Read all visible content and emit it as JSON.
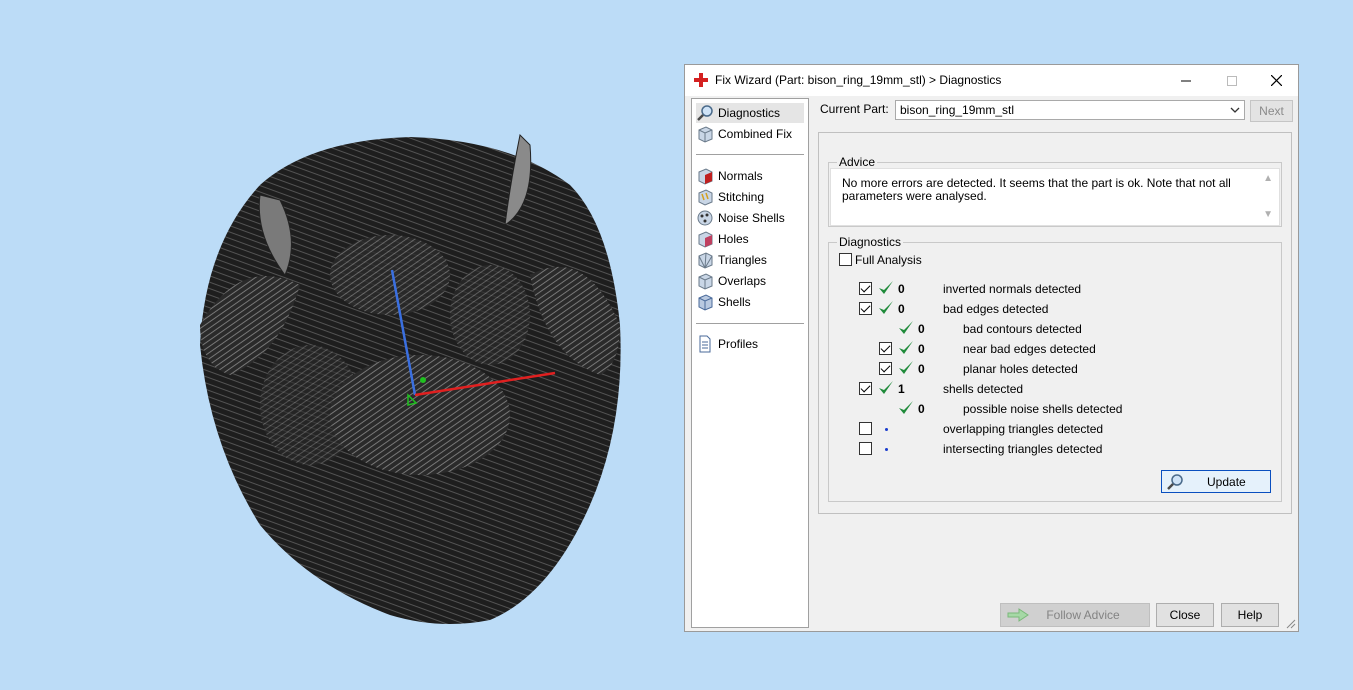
{
  "window": {
    "title": "Fix Wizard (Part: bison_ring_19mm_stl) > Diagnostics",
    "minimize_icon": "minimize-icon",
    "maximize_icon": "maximize-icon",
    "close_icon": "close-icon"
  },
  "nav": {
    "top": [
      {
        "label": "Diagnostics",
        "icon": "magnifier-icon",
        "selected": true
      },
      {
        "label": "Combined Fix",
        "icon": "cube-icon"
      }
    ],
    "fixes": [
      {
        "label": "Normals",
        "icon": "normals-cube-icon"
      },
      {
        "label": "Stitching",
        "icon": "stitching-cube-icon"
      },
      {
        "label": "Noise Shells",
        "icon": "noise-shells-icon"
      },
      {
        "label": "Holes",
        "icon": "holes-cube-icon"
      },
      {
        "label": "Triangles",
        "icon": "triangles-cube-icon"
      },
      {
        "label": "Overlaps",
        "icon": "overlaps-cube-icon"
      },
      {
        "label": "Shells",
        "icon": "shells-cube-icon"
      }
    ],
    "bottom": [
      {
        "label": "Profiles",
        "icon": "document-icon"
      }
    ]
  },
  "current_part": {
    "label": "Current Part:",
    "value": "bison_ring_19mm_stl",
    "next_label": "Next"
  },
  "advice": {
    "title": "Advice",
    "text": "No more errors are detected. It seems that the part is ok. Note that not all parameters were analysed."
  },
  "diagnostics": {
    "title": "Diagnostics",
    "full_analysis_label": "Full Analysis",
    "full_analysis_checked": false,
    "rows": [
      {
        "checkbox": true,
        "checked": true,
        "status": "ok",
        "count": "0",
        "label": "inverted normals detected",
        "indent": 0
      },
      {
        "checkbox": true,
        "checked": true,
        "status": "ok",
        "count": "0",
        "label": "bad edges detected",
        "indent": 0
      },
      {
        "checkbox": false,
        "checked": false,
        "status": "ok",
        "count": "0",
        "label": "bad contours detected",
        "indent": 1
      },
      {
        "checkbox": true,
        "checked": true,
        "status": "ok",
        "count": "0",
        "label": "near bad edges detected",
        "indent": 1
      },
      {
        "checkbox": true,
        "checked": true,
        "status": "ok",
        "count": "0",
        "label": "planar holes detected",
        "indent": 1
      },
      {
        "checkbox": true,
        "checked": true,
        "status": "ok",
        "count": "1",
        "label": "shells detected",
        "indent": 0
      },
      {
        "checkbox": false,
        "checked": false,
        "status": "ok",
        "count": "0",
        "label": "possible noise shells detected",
        "indent": 1
      },
      {
        "checkbox": true,
        "checked": false,
        "status": "pending",
        "count": "",
        "label": "overlapping triangles detected",
        "indent": 0
      },
      {
        "checkbox": true,
        "checked": false,
        "status": "pending",
        "count": "",
        "label": "intersecting triangles detected",
        "indent": 0
      }
    ],
    "update_label": "Update"
  },
  "footer": {
    "follow_advice_label": "Follow Advice",
    "close_label": "Close",
    "help_label": "Help"
  },
  "colors": {
    "background": "#bcdcf7",
    "check_green": "#1f8a3a",
    "x_axis": "#e02020",
    "y_axis": "#3a6fe0",
    "origin": "#20c020"
  }
}
